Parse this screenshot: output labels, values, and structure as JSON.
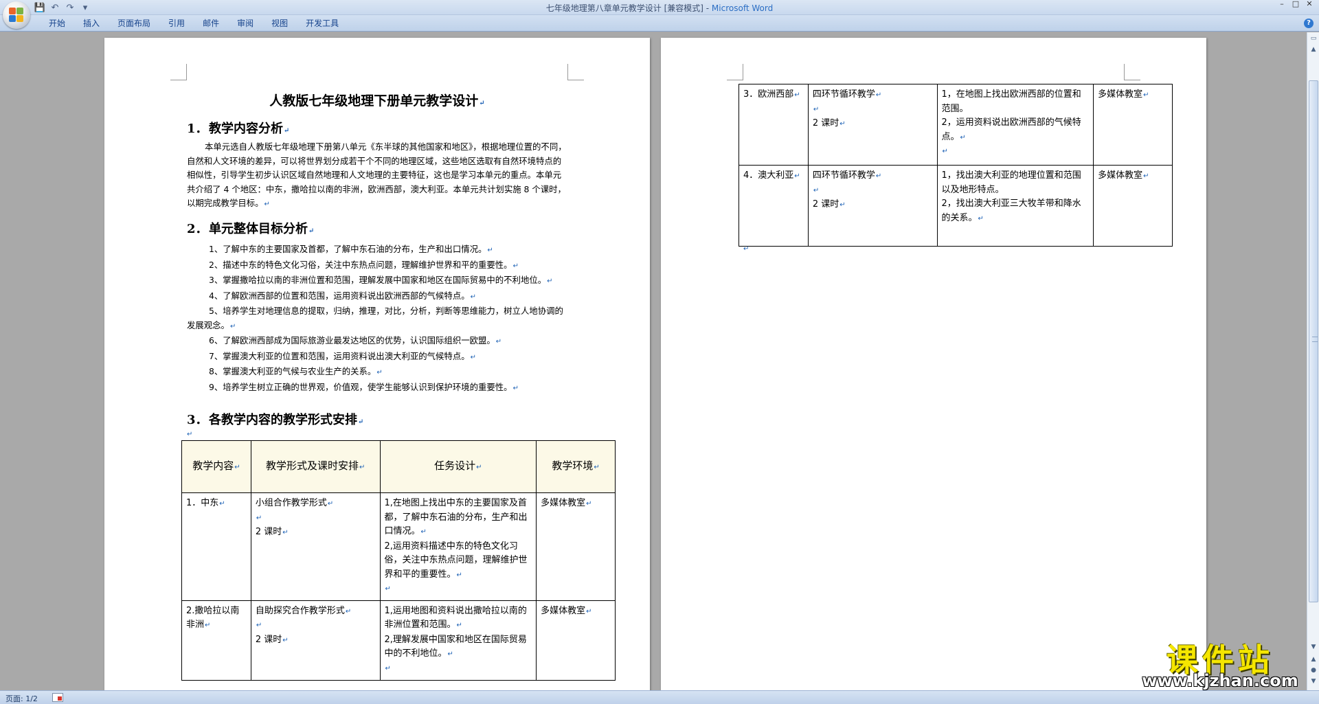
{
  "window": {
    "title_doc": "七年级地理第八章单元教学设计 [兼容模式] - ",
    "title_app": "Microsoft Word",
    "controls": [
      "–",
      "□",
      "✕"
    ]
  },
  "quick_access": {
    "save_icon": "💾",
    "undo_icon": "↶",
    "redo_icon": "↷",
    "menu_icon": "▾"
  },
  "ribbon": {
    "tabs": [
      "开始",
      "插入",
      "页面布局",
      "引用",
      "邮件",
      "审阅",
      "视图",
      "开发工具"
    ],
    "help": "?"
  },
  "page1": {
    "title": "人教版七年级地理下册单元教学设计",
    "sections": [
      {
        "num": "1．",
        "title": "教学内容分析"
      },
      {
        "num": "2．",
        "title": "单元整体目标分析"
      },
      {
        "num": "3．",
        "title": "各教学内容的教学形式安排"
      }
    ],
    "intro": "本单元选自人教版七年级地理下册第八单元《东半球的其他国家和地区》，根据地理位置的不同，自然和人文环境的差异，可以将世界划分成若干个不同的地理区域，这些地区选取有自然环境特点的相似性，引导学生初步认识区域自然地理和人文地理的主要特征，这也是学习本单元的重点。本单元共介绍了 4 个地区：中东，撒哈拉以南的非洲，欧洲西部，澳大利亚。本单元共计划实施 8 个课时，以期完成教学目标。",
    "objectives": [
      "1、了解中东的主要国家及首都，了解中东石油的分布，生产和出口情况。",
      "2、描述中东的特色文化习俗，关注中东热点问题，理解维护世界和平的重要性。",
      "3、掌握撒哈拉以南的非洲位置和范围，理解发展中国家和地区在国际贸易中的不利地位。",
      "4、了解欧洲西部的位置和范围，运用资料说出欧洲西部的气候特点。",
      "5、培养学生对地理信息的提取，归纳，推理，对比，分析，判断等思维能力，树立人地协调的发展观念。",
      "6、了解欧洲西部成为国际旅游业最发达地区的优势，认识国际组织一欧盟。",
      "7、掌握澳大利亚的位置和范围，运用资料说出澳大利亚的气候特点。",
      "8、掌握澳大利亚的气候与农业生产的关系。",
      "9、培养学生树立正确的世界观，价值观，使学生能够认识到保护环境的重要性。"
    ],
    "table_headers": [
      "教学内容",
      "教学形式及课时安排",
      "任务设计",
      "教学环境"
    ],
    "table_rows": [
      {
        "content": "1．中东",
        "form": "小组合作教学形式",
        "hours": "2 课时",
        "tasks": [
          "1,在地图上找出中东的主要国家及首都，了解中东石油的分布，生产和出口情况。",
          "2,运用资料描述中东的特色文化习俗，关注中东热点问题，理解维护世界和平的重要性。"
        ],
        "env": "多媒体教室"
      },
      {
        "content": "2.撒哈拉以南非洲",
        "form": "自助探究合作教学形式",
        "hours": "2 课时",
        "tasks": [
          "1,运用地图和资料说出撒哈拉以南的非洲位置和范围。",
          "2,理解发展中国家和地区在国际贸易中的不利地位。"
        ],
        "env": "多媒体教室"
      }
    ]
  },
  "page2": {
    "table_rows": [
      {
        "content": "3．欧洲西部",
        "form": "四环节循环教学",
        "hours": "2 课时",
        "tasks": [
          "1，在地图上找出欧洲西部的位置和范围。",
          "2，运用资料说出欧洲西部的气候特点。"
        ],
        "env": "多媒体教室"
      },
      {
        "content": "4．澳大利亚",
        "form": "四环节循环教学",
        "hours": "2 课时",
        "tasks": [
          "1，找出澳大利亚的地理位置和范围以及地形特点。",
          "2，找出澳大利亚三大牧羊带和降水的关系。"
        ],
        "env": "多媒体教室"
      }
    ]
  },
  "paragraph_mark": "↵",
  "status": {
    "page_count": "页面: 1/2"
  },
  "watermark": {
    "text": "课件站",
    "url": "www.kjzhan.com"
  }
}
